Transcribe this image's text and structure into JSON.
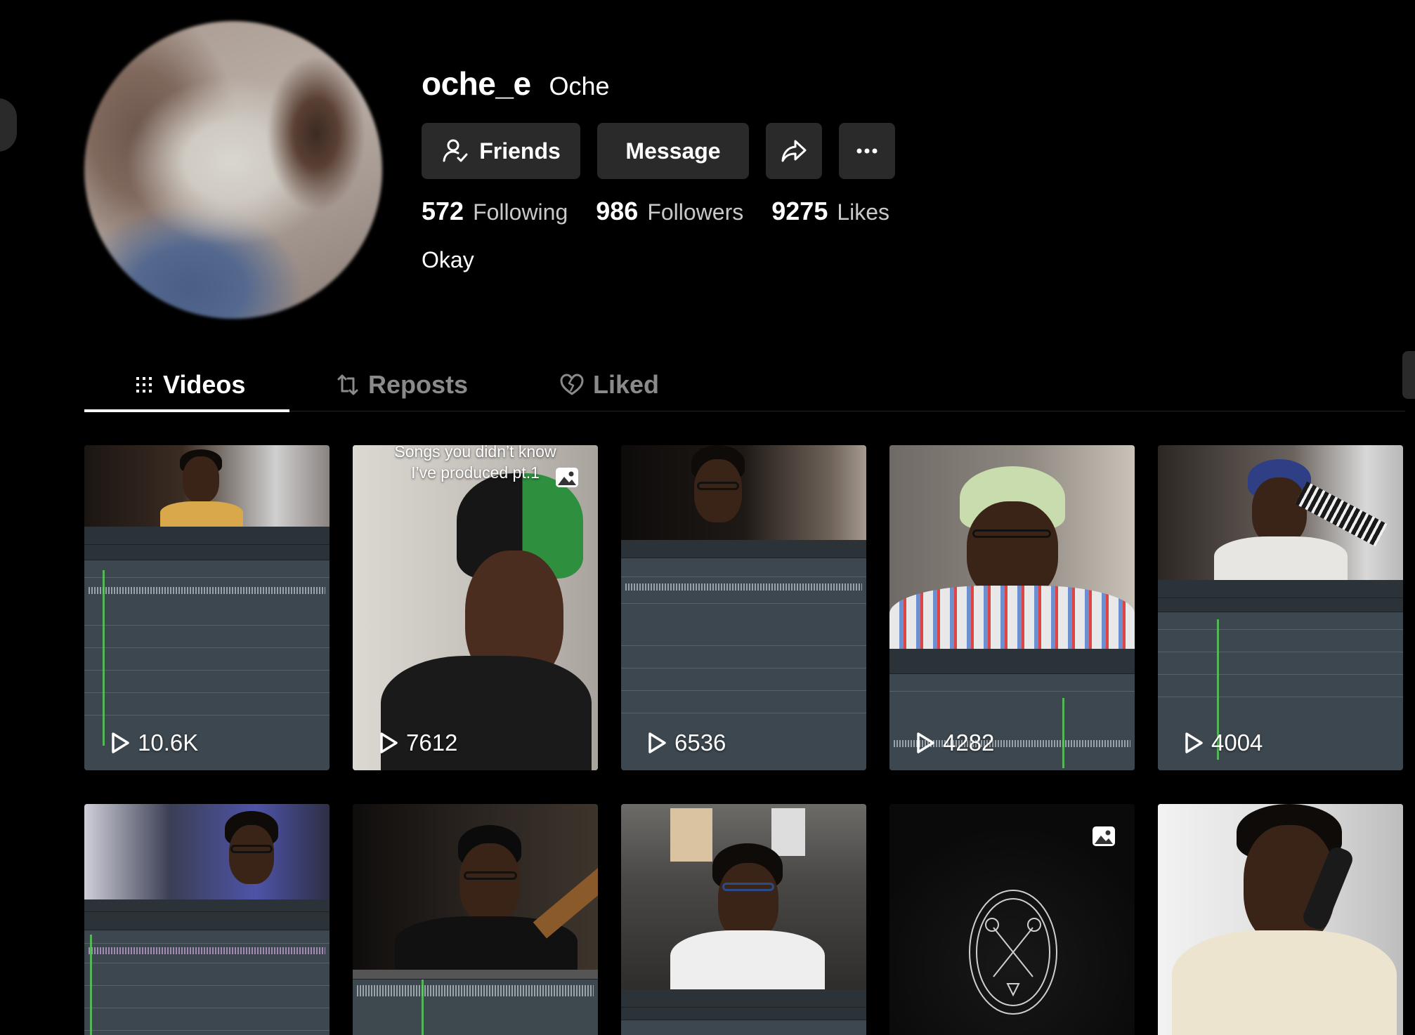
{
  "profile": {
    "username": "oche_e",
    "nickname": "Oche",
    "bio": "Okay",
    "avatar_icon": "profile-photo"
  },
  "actions": {
    "friends_label": "Friends",
    "message_label": "Message",
    "share_icon": "share-arrow-icon",
    "more_icon": "ellipsis-icon"
  },
  "stats": {
    "following_count": "572",
    "following_label": "Following",
    "followers_count": "986",
    "followers_label": "Followers",
    "likes_count": "9275",
    "likes_label": "Likes"
  },
  "tabs": [
    {
      "label": "Videos",
      "icon": "grid-icon",
      "active": true
    },
    {
      "label": "Reposts",
      "icon": "repost-icon",
      "active": false
    },
    {
      "label": "Liked",
      "icon": "heart-icon",
      "active": false
    }
  ],
  "videos": [
    {
      "views": "10.6K",
      "type": "video"
    },
    {
      "views": "7612",
      "type": "photo",
      "overlay": "Songs you didn’t know\nI’ve produced pt.1"
    },
    {
      "views": "6536",
      "type": "video"
    },
    {
      "views": "4282",
      "type": "video"
    },
    {
      "views": "4004",
      "type": "video"
    },
    {
      "type": "video"
    },
    {
      "type": "video"
    },
    {
      "type": "video"
    },
    {
      "type": "photo"
    },
    {
      "type": "video"
    }
  ],
  "colors": {
    "background": "#000000",
    "button_bg": "#2a2a2a",
    "muted_text": "#8a8a8a"
  }
}
